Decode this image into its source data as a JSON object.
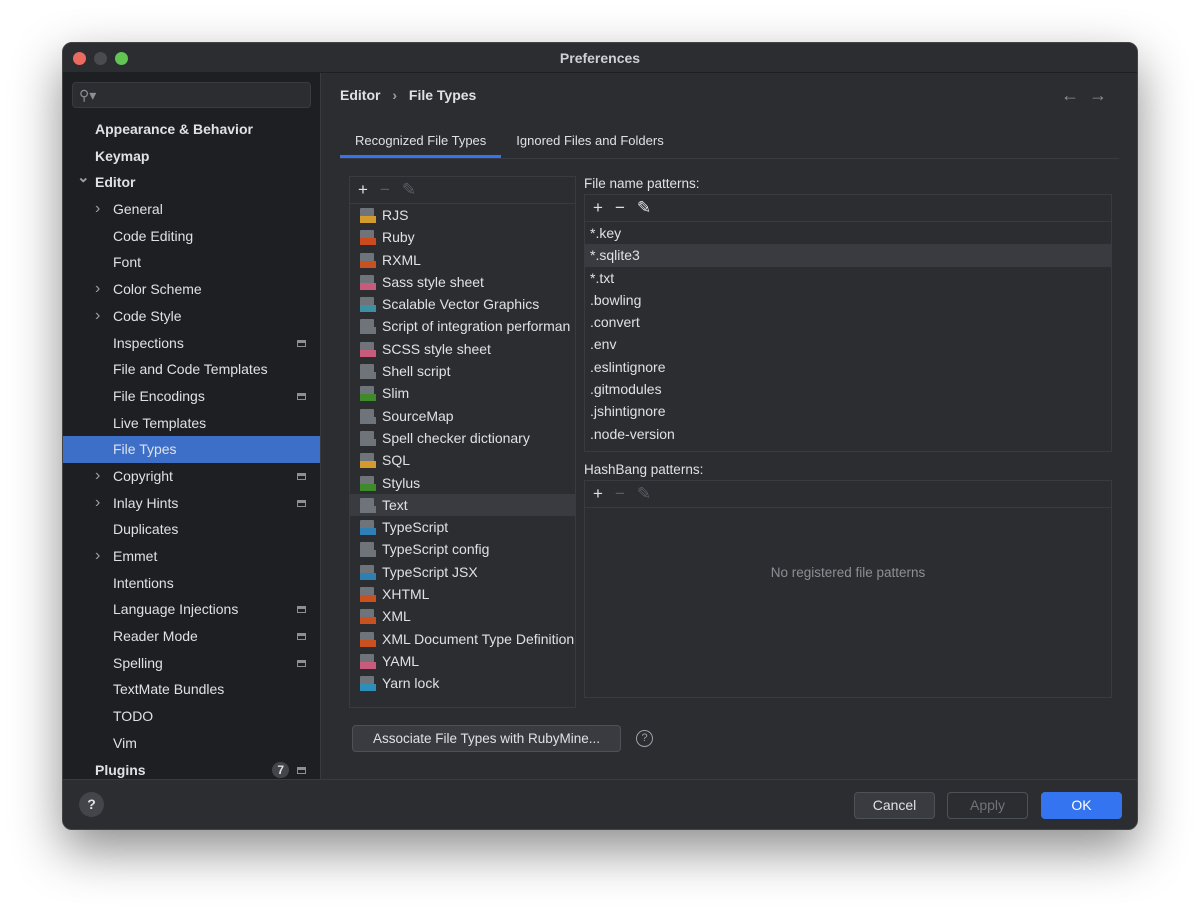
{
  "window": {
    "title": "Preferences",
    "colors": {
      "close": "#ec6a5e",
      "min": "#4a4b4e",
      "max": "#61c554",
      "accent": "#3574f0",
      "selection": "#3d6fc9"
    }
  },
  "sidebar": {
    "search_placeholder": "",
    "search_icon": "search-icon",
    "items": [
      {
        "label": "Appearance & Behavior",
        "bold": true,
        "indent": 0
      },
      {
        "label": "Keymap",
        "bold": true,
        "indent": 0
      },
      {
        "label": "Editor",
        "bold": true,
        "indent": 0,
        "chevron": "down"
      },
      {
        "label": "General",
        "indent": 1,
        "chevron": "right"
      },
      {
        "label": "Code Editing",
        "indent": 1
      },
      {
        "label": "Font",
        "indent": 1
      },
      {
        "label": "Color Scheme",
        "indent": 1,
        "chevron": "right"
      },
      {
        "label": "Code Style",
        "indent": 1,
        "chevron": "right"
      },
      {
        "label": "Inspections",
        "indent": 1,
        "badge": true
      },
      {
        "label": "File and Code Templates",
        "indent": 1
      },
      {
        "label": "File Encodings",
        "indent": 1,
        "badge": true
      },
      {
        "label": "Live Templates",
        "indent": 1
      },
      {
        "label": "File Types",
        "indent": 1,
        "selected": true
      },
      {
        "label": "Copyright",
        "indent": 1,
        "chevron": "right",
        "badge": true
      },
      {
        "label": "Inlay Hints",
        "indent": 1,
        "chevron": "right",
        "badge": true
      },
      {
        "label": "Duplicates",
        "indent": 1
      },
      {
        "label": "Emmet",
        "indent": 1,
        "chevron": "right"
      },
      {
        "label": "Intentions",
        "indent": 1
      },
      {
        "label": "Language Injections",
        "indent": 1,
        "badge": true
      },
      {
        "label": "Reader Mode",
        "indent": 1,
        "badge": true
      },
      {
        "label": "Spelling",
        "indent": 1,
        "badge": true
      },
      {
        "label": "TextMate Bundles",
        "indent": 1
      },
      {
        "label": "TODO",
        "indent": 1
      },
      {
        "label": "Vim",
        "indent": 1
      },
      {
        "label": "Plugins",
        "bold": true,
        "indent": 0,
        "count": "7",
        "badge": true
      }
    ]
  },
  "breadcrumb": {
    "parent": "Editor",
    "sep": "›",
    "current": "File Types"
  },
  "tabs": [
    {
      "label": "Recognized File Types",
      "active": true
    },
    {
      "label": "Ignored Files and Folders"
    }
  ],
  "file_types": [
    {
      "label": "RJS",
      "color": "#d39b2e"
    },
    {
      "label": "Ruby",
      "color": "#cc4a1e"
    },
    {
      "label": "RXML",
      "color": "#c9511f"
    },
    {
      "label": "Sass style sheet",
      "color": "#c85a7c"
    },
    {
      "label": "Scalable Vector Graphics",
      "color": "#3d8fa3"
    },
    {
      "label": "Script of integration performan",
      "color": "#6f737a"
    },
    {
      "label": "SCSS style sheet",
      "color": "#c85a7c"
    },
    {
      "label": "Shell script",
      "color": "#6f737a"
    },
    {
      "label": "Slim",
      "color": "#3f8a2a"
    },
    {
      "label": "SourceMap",
      "color": "#6f737a"
    },
    {
      "label": "Spell checker dictionary",
      "color": "#6f737a"
    },
    {
      "label": "SQL",
      "color": "#d39b2e"
    },
    {
      "label": "Stylus",
      "color": "#3f8a2a"
    },
    {
      "label": "Text",
      "color": "#6f737a",
      "selected": true
    },
    {
      "label": "TypeScript",
      "color": "#2f7fb5"
    },
    {
      "label": "TypeScript config",
      "color": "#6f737a"
    },
    {
      "label": "TypeScript JSX",
      "color": "#2f7fb5"
    },
    {
      "label": "XHTML",
      "color": "#c9511f"
    },
    {
      "label": "XML",
      "color": "#c9511f"
    },
    {
      "label": "XML Document Type Definition",
      "color": "#c9511f"
    },
    {
      "label": "YAML",
      "color": "#c85a7c"
    },
    {
      "label": "Yarn lock",
      "color": "#2c8ebb"
    }
  ],
  "file_name_patterns": {
    "label": "File name patterns:",
    "items": [
      "*.key",
      "*.sqlite3",
      "*.txt",
      ".bowling",
      ".convert",
      ".env",
      ".eslintignore",
      ".gitmodules",
      ".jshintignore",
      ".node-version"
    ],
    "selected": 1
  },
  "hashbang_patterns": {
    "label": "HashBang patterns:",
    "empty_text": "No registered file patterns"
  },
  "toolbar": {
    "add": "+",
    "remove": "−",
    "edit": "✎"
  },
  "associate_button": "Associate File Types with RubyMine...",
  "help_glyph": "?",
  "footer": {
    "help": "?",
    "cancel": "Cancel",
    "apply": "Apply",
    "ok": "OK"
  }
}
